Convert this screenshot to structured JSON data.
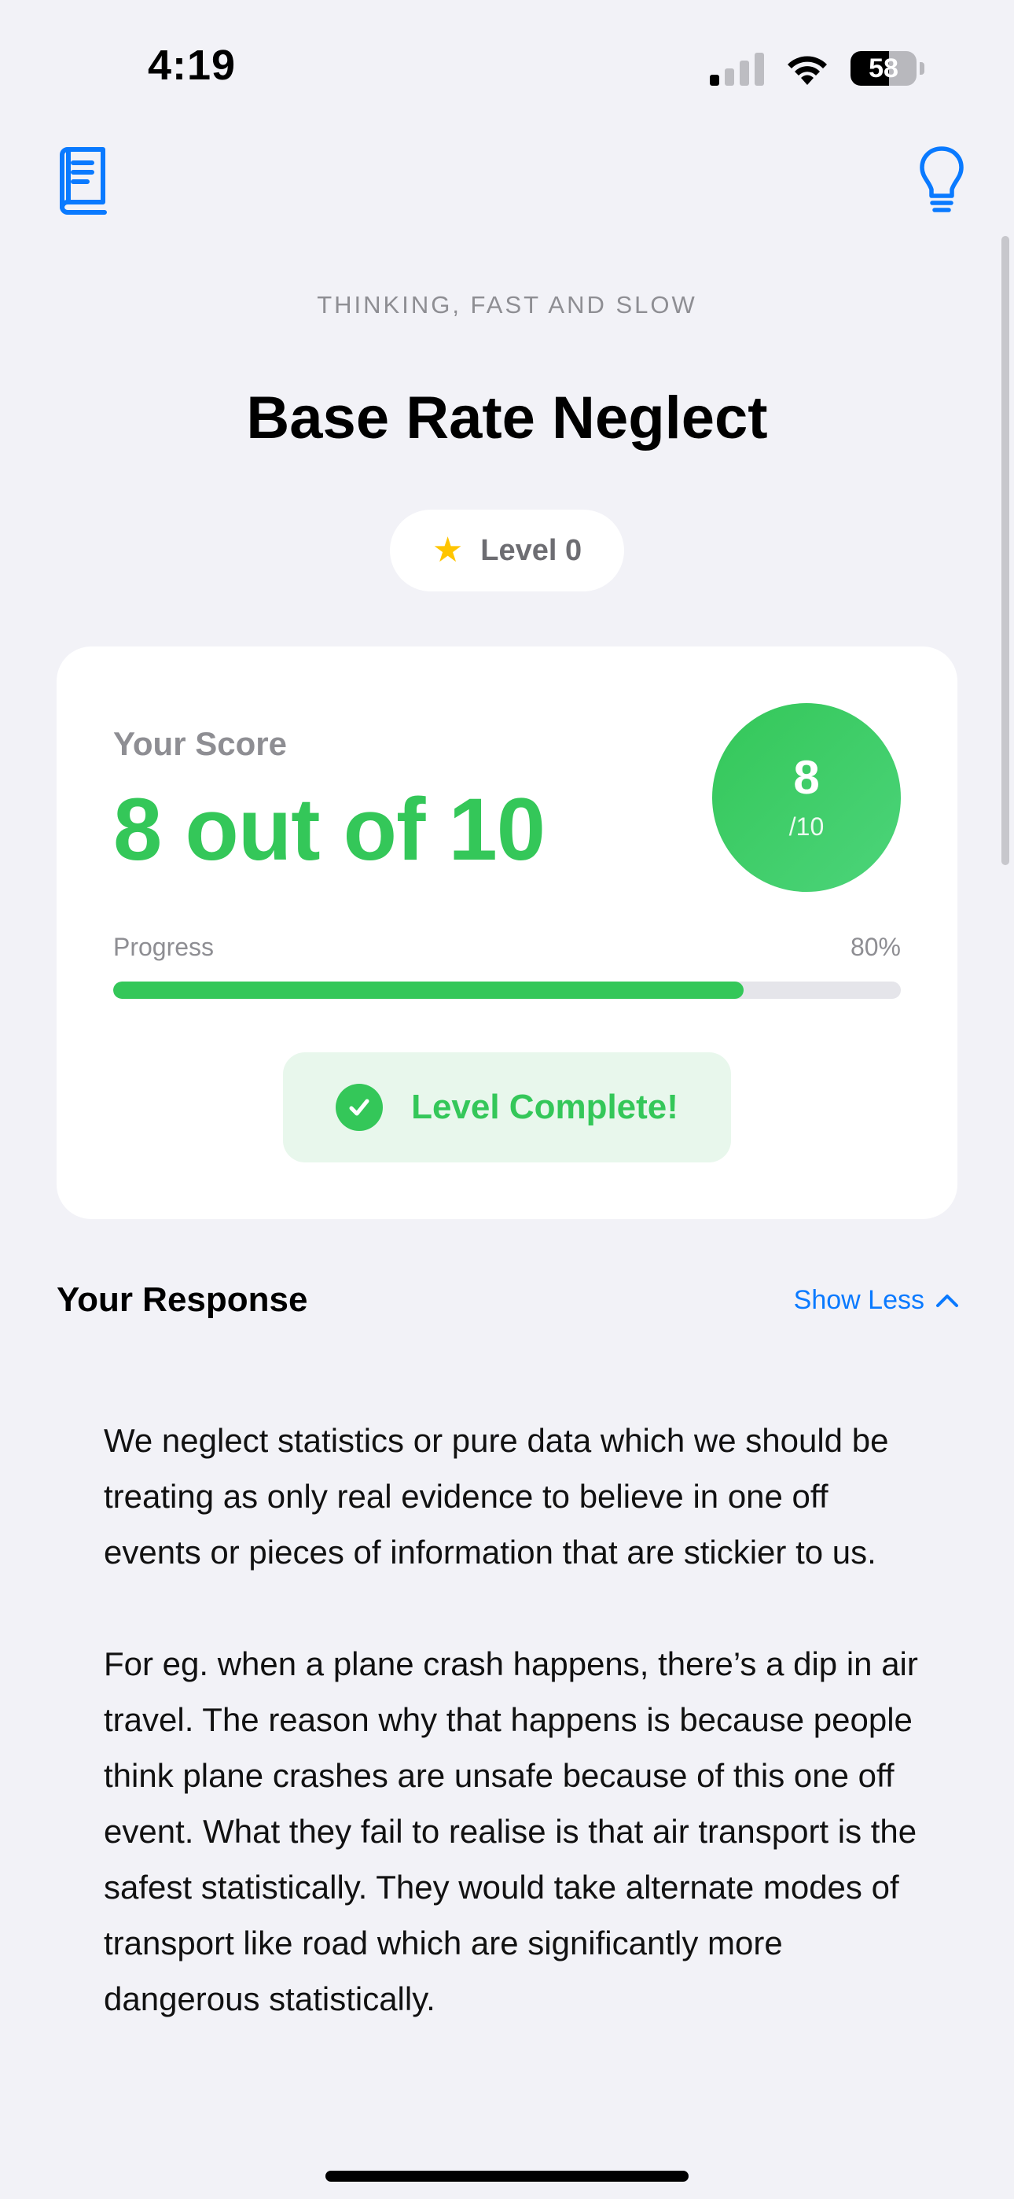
{
  "status_bar": {
    "time": "4:19",
    "battery": "58",
    "battery_level": 0.58
  },
  "header": {
    "book_title": "THINKING, FAST AND SLOW",
    "title": "Base Rate Neglect",
    "level_label": "Level 0"
  },
  "score_card": {
    "label": "Your Score",
    "value_text": "8 out of 10",
    "circle_value": "8",
    "circle_total": "/10",
    "progress_label": "Progress",
    "progress_percent": "80%",
    "progress": 0.8,
    "complete_label": "Level Complete!"
  },
  "response": {
    "title": "Your Response",
    "toggle_label": "Show Less",
    "paragraphs": [
      "We neglect statistics or pure data which we should be treating as only real evidence to believe in one off events or pieces of information that are stickier to us.",
      "For eg. when a plane crash happens, there’s a dip in air travel. The reason why that happens is because people think plane crashes are unsafe because of this one off event. What they fail to realise is that air transport is the safest statistically. They would take alternate modes of transport like road which are significantly more dangerous statistically."
    ]
  },
  "colors": {
    "accent_blue": "#0A7AFF",
    "success_green": "#34C759",
    "star_yellow": "#FFC500",
    "background": "#F2F2F7"
  },
  "icons": {
    "left": "book-icon",
    "right": "lightbulb-icon",
    "badge": "star-icon",
    "complete": "checkmark-circle-icon",
    "toggle": "chevron-up-icon"
  }
}
